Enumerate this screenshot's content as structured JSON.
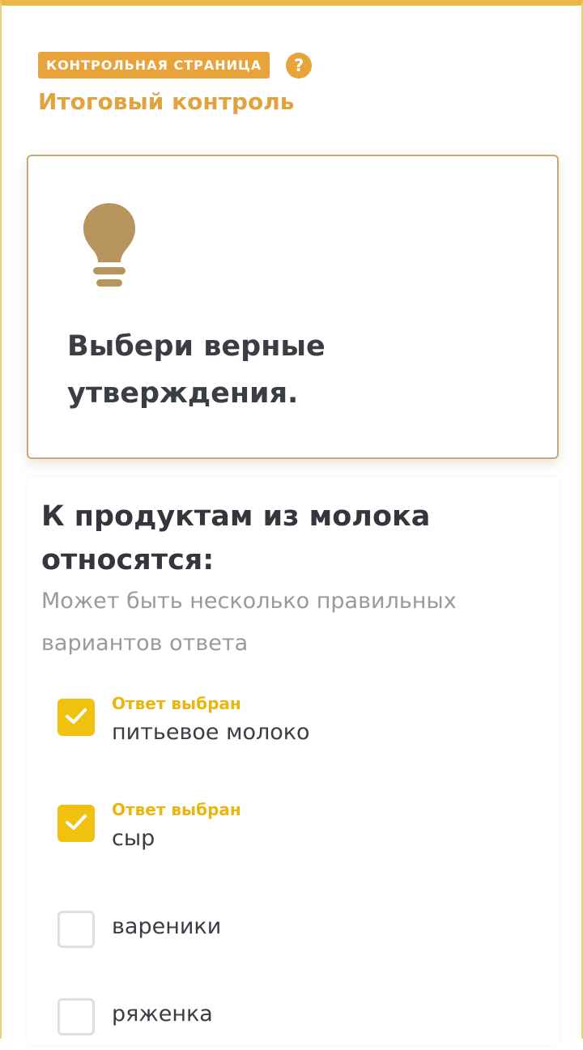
{
  "header": {
    "badge": "КОНТРОЛЬНАЯ СТРАНИЦА",
    "help_icon": "question-circle-icon",
    "help_symbol": "?",
    "title": "Итоговый контроль"
  },
  "task": {
    "icon": "lightbulb-icon",
    "text": "Выбери верные утверждения."
  },
  "question": {
    "title": "К продуктам из молока относятся:",
    "hint": "Может быть несколько правильных вариантов ответа",
    "options": [
      {
        "label": "питьевое молоко",
        "status": "Ответ выбран",
        "checked": true
      },
      {
        "label": "сыр",
        "status": "Ответ выбран",
        "checked": true
      },
      {
        "label": "вареники",
        "status": "",
        "checked": false
      },
      {
        "label": "ряженка",
        "status": "",
        "checked": false
      }
    ]
  },
  "colors": {
    "accent": "#e8a33a",
    "checkbox_checked": "#f0c10f",
    "status_text": "#e8b60f",
    "card_border": "#c8a87a",
    "bulb": "#b8955e"
  }
}
